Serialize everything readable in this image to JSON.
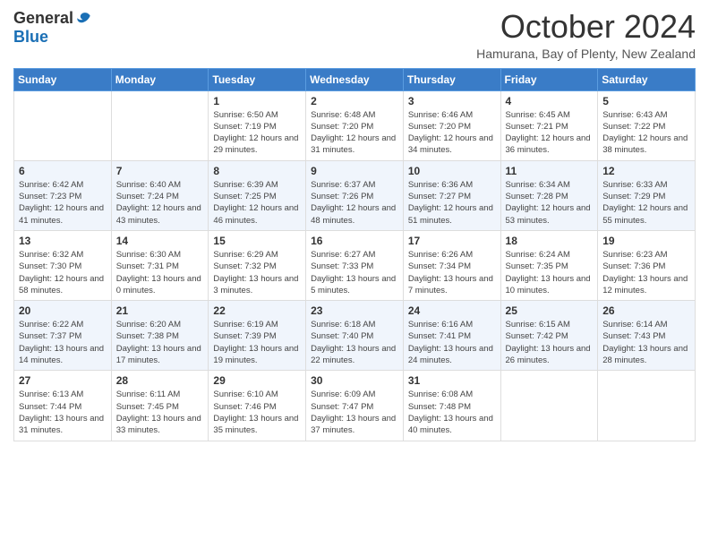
{
  "logo": {
    "general": "General",
    "blue": "Blue"
  },
  "title": {
    "month_year": "October 2024",
    "location": "Hamurana, Bay of Plenty, New Zealand"
  },
  "days_of_week": [
    "Sunday",
    "Monday",
    "Tuesday",
    "Wednesday",
    "Thursday",
    "Friday",
    "Saturday"
  ],
  "weeks": [
    [
      {
        "day": "",
        "info": ""
      },
      {
        "day": "",
        "info": ""
      },
      {
        "day": "1",
        "info": "Sunrise: 6:50 AM\nSunset: 7:19 PM\nDaylight: 12 hours and 29 minutes."
      },
      {
        "day": "2",
        "info": "Sunrise: 6:48 AM\nSunset: 7:20 PM\nDaylight: 12 hours and 31 minutes."
      },
      {
        "day": "3",
        "info": "Sunrise: 6:46 AM\nSunset: 7:20 PM\nDaylight: 12 hours and 34 minutes."
      },
      {
        "day": "4",
        "info": "Sunrise: 6:45 AM\nSunset: 7:21 PM\nDaylight: 12 hours and 36 minutes."
      },
      {
        "day": "5",
        "info": "Sunrise: 6:43 AM\nSunset: 7:22 PM\nDaylight: 12 hours and 38 minutes."
      }
    ],
    [
      {
        "day": "6",
        "info": "Sunrise: 6:42 AM\nSunset: 7:23 PM\nDaylight: 12 hours and 41 minutes."
      },
      {
        "day": "7",
        "info": "Sunrise: 6:40 AM\nSunset: 7:24 PM\nDaylight: 12 hours and 43 minutes."
      },
      {
        "day": "8",
        "info": "Sunrise: 6:39 AM\nSunset: 7:25 PM\nDaylight: 12 hours and 46 minutes."
      },
      {
        "day": "9",
        "info": "Sunrise: 6:37 AM\nSunset: 7:26 PM\nDaylight: 12 hours and 48 minutes."
      },
      {
        "day": "10",
        "info": "Sunrise: 6:36 AM\nSunset: 7:27 PM\nDaylight: 12 hours and 51 minutes."
      },
      {
        "day": "11",
        "info": "Sunrise: 6:34 AM\nSunset: 7:28 PM\nDaylight: 12 hours and 53 minutes."
      },
      {
        "day": "12",
        "info": "Sunrise: 6:33 AM\nSunset: 7:29 PM\nDaylight: 12 hours and 55 minutes."
      }
    ],
    [
      {
        "day": "13",
        "info": "Sunrise: 6:32 AM\nSunset: 7:30 PM\nDaylight: 12 hours and 58 minutes."
      },
      {
        "day": "14",
        "info": "Sunrise: 6:30 AM\nSunset: 7:31 PM\nDaylight: 13 hours and 0 minutes."
      },
      {
        "day": "15",
        "info": "Sunrise: 6:29 AM\nSunset: 7:32 PM\nDaylight: 13 hours and 3 minutes."
      },
      {
        "day": "16",
        "info": "Sunrise: 6:27 AM\nSunset: 7:33 PM\nDaylight: 13 hours and 5 minutes."
      },
      {
        "day": "17",
        "info": "Sunrise: 6:26 AM\nSunset: 7:34 PM\nDaylight: 13 hours and 7 minutes."
      },
      {
        "day": "18",
        "info": "Sunrise: 6:24 AM\nSunset: 7:35 PM\nDaylight: 13 hours and 10 minutes."
      },
      {
        "day": "19",
        "info": "Sunrise: 6:23 AM\nSunset: 7:36 PM\nDaylight: 13 hours and 12 minutes."
      }
    ],
    [
      {
        "day": "20",
        "info": "Sunrise: 6:22 AM\nSunset: 7:37 PM\nDaylight: 13 hours and 14 minutes."
      },
      {
        "day": "21",
        "info": "Sunrise: 6:20 AM\nSunset: 7:38 PM\nDaylight: 13 hours and 17 minutes."
      },
      {
        "day": "22",
        "info": "Sunrise: 6:19 AM\nSunset: 7:39 PM\nDaylight: 13 hours and 19 minutes."
      },
      {
        "day": "23",
        "info": "Sunrise: 6:18 AM\nSunset: 7:40 PM\nDaylight: 13 hours and 22 minutes."
      },
      {
        "day": "24",
        "info": "Sunrise: 6:16 AM\nSunset: 7:41 PM\nDaylight: 13 hours and 24 minutes."
      },
      {
        "day": "25",
        "info": "Sunrise: 6:15 AM\nSunset: 7:42 PM\nDaylight: 13 hours and 26 minutes."
      },
      {
        "day": "26",
        "info": "Sunrise: 6:14 AM\nSunset: 7:43 PM\nDaylight: 13 hours and 28 minutes."
      }
    ],
    [
      {
        "day": "27",
        "info": "Sunrise: 6:13 AM\nSunset: 7:44 PM\nDaylight: 13 hours and 31 minutes."
      },
      {
        "day": "28",
        "info": "Sunrise: 6:11 AM\nSunset: 7:45 PM\nDaylight: 13 hours and 33 minutes."
      },
      {
        "day": "29",
        "info": "Sunrise: 6:10 AM\nSunset: 7:46 PM\nDaylight: 13 hours and 35 minutes."
      },
      {
        "day": "30",
        "info": "Sunrise: 6:09 AM\nSunset: 7:47 PM\nDaylight: 13 hours and 37 minutes."
      },
      {
        "day": "31",
        "info": "Sunrise: 6:08 AM\nSunset: 7:48 PM\nDaylight: 13 hours and 40 minutes."
      },
      {
        "day": "",
        "info": ""
      },
      {
        "day": "",
        "info": ""
      }
    ]
  ]
}
